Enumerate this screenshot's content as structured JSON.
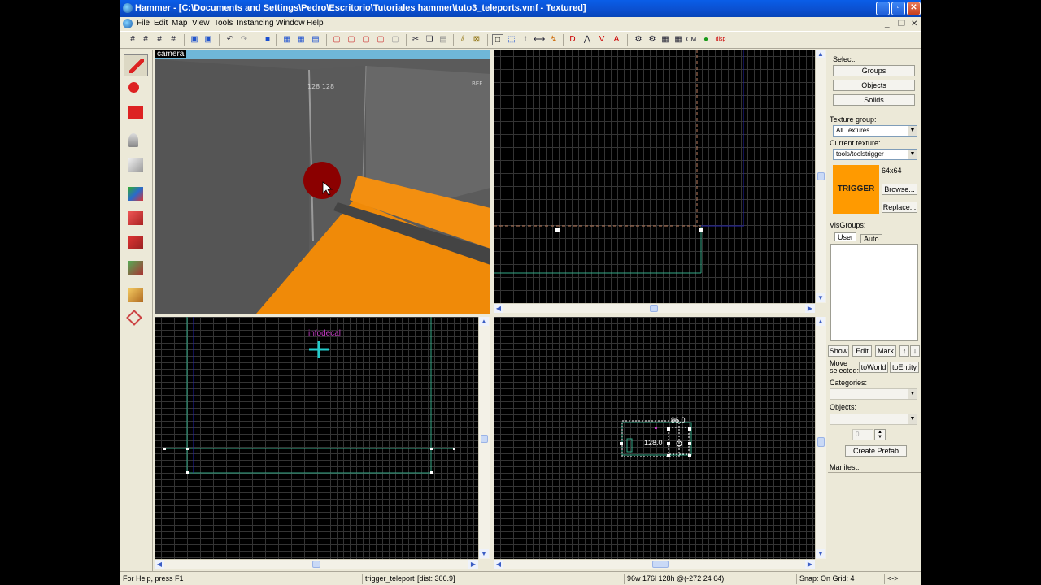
{
  "window": {
    "title": "Hammer - [C:\\Documents and Settings\\Pedro\\Escritorio\\Tutoriales hammer\\tuto3_teleports.vmf - Textured]"
  },
  "menu": {
    "items": [
      "File",
      "Edit",
      "Map",
      "View",
      "Tools",
      "Instancing",
      "Window",
      "Help"
    ]
  },
  "toolbar": {
    "buttons": [
      "grid-toggle",
      "grid-smaller",
      "grid-larger",
      "3d-grid",
      "group",
      "ungroup",
      "undo",
      "redo",
      "carve",
      "hollow",
      "texture-lock",
      "texture-lock-scale",
      "quick-hide",
      "to-world",
      "to-entity",
      "cut",
      "copy",
      "paste",
      "clip",
      "vertex",
      "select",
      "texture",
      "entity-report",
      "decal",
      "check-problems",
      "compile",
      "map-props",
      "cordon",
      "overlay",
      "cm",
      "paint-geo",
      "displacement"
    ]
  },
  "left_tools": [
    "selection-tool",
    "magnify-tool",
    "camera-tool",
    "entity-tool",
    "block-tool",
    "texture-application-tool",
    "apply-current-texture",
    "apply-decals",
    "apply-overlays",
    "clipping-tool",
    "vertex-tool"
  ],
  "viewports": {
    "camera_label": "camera",
    "camera_wall_text_1": "128 128",
    "camera_wall_text_2": "BEF",
    "top_left_entity": "infodecal",
    "bottom_right_dim_width": "96.0",
    "bottom_right_dim_height": "128.0"
  },
  "right_panel": {
    "select_label": "Select:",
    "groups_button": "Groups",
    "objects_button": "Objects",
    "solids_button": "Solids",
    "texture_group_label": "Texture group:",
    "texture_group_value": "All Textures",
    "current_texture_label": "Current texture:",
    "current_texture_value": "tools/toolstrigger",
    "texture_size": "64x64",
    "texture_preview_text": "TRIGGER",
    "browse_button": "Browse...",
    "replace_button": "Replace...",
    "visgroups_label": "VisGroups:",
    "tab_user": "User",
    "tab_auto": "Auto",
    "show_button": "Show",
    "edit_button": "Edit",
    "mark_button": "Mark",
    "move_selected_label": "Move selected:",
    "to_world_button": "toWorld",
    "to_entity_button": "toEntity",
    "categories_label": "Categories:",
    "objects_label": "Objects:",
    "spinner_value": "0",
    "create_prefab_button": "Create Prefab",
    "manifest_label": "Manifest:"
  },
  "statusbar": {
    "help": "For Help, press F1",
    "selection": "trigger_teleport",
    "distance": "[dist: 306.9]",
    "size": "96w 176l 128h @(-272 24 64)",
    "snap": "Snap: On Grid: 4",
    "extra": "<->"
  },
  "colors": {
    "title_blue": "#0a5ee8",
    "trigger_orange": "#ff9a00",
    "grid_line": "#343434"
  }
}
